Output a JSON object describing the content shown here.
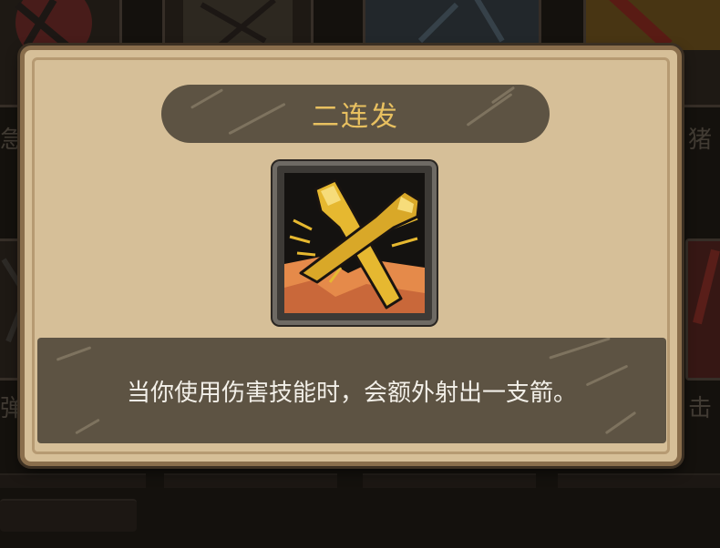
{
  "background": {
    "labels": {
      "left_top": "急",
      "right_top": "猪",
      "left_bottom": "弹",
      "right_bottom": "击"
    }
  },
  "dialog": {
    "title": "二连发",
    "icon": "crossed-arrows-icon",
    "description": "当你使用伤害技能时，会额外射出一支箭。"
  },
  "colors": {
    "dialog_bg": "#d6bf98",
    "banner_bg": "#5d5343",
    "title_text": "#e8c060",
    "description_text": "#f2efe8",
    "arrow_gold": "#e6b830",
    "icon_bg": "#141210"
  }
}
